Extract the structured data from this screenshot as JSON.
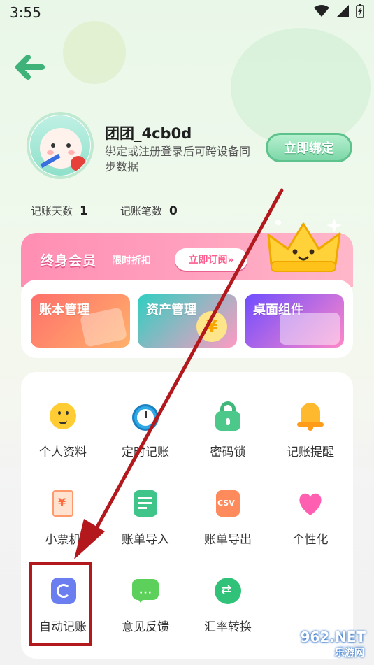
{
  "status_bar": {
    "time": "3:55"
  },
  "profile": {
    "username": "团团_4cb0d",
    "description": "绑定或注册登录后可跨设备同步数据",
    "bind_button": "立即绑定"
  },
  "stats": [
    {
      "label": "记账天数",
      "value": "1"
    },
    {
      "label": "记账笔数",
      "value": "0"
    }
  ],
  "vip": {
    "title": "终身会员",
    "subtitle": "限时折扣",
    "button": "立即订阅»"
  },
  "feature_cards": [
    {
      "label": "账本管理",
      "color_from": "#ff7a6b",
      "color_to": "#ffb36b"
    },
    {
      "label": "资产管理",
      "color_from": "#37d1c4",
      "color_to": "#ff9ac2"
    },
    {
      "label": "桌面组件",
      "color_from": "#7b5cff",
      "color_to": "#ff8acb"
    }
  ],
  "grid": [
    {
      "label": "个人资料",
      "icon": "smiley-face-icon"
    },
    {
      "label": "定时记账",
      "icon": "alarm-clock-icon"
    },
    {
      "label": "密码锁",
      "icon": "padlock-icon"
    },
    {
      "label": "记账提醒",
      "icon": "bell-icon"
    },
    {
      "label": "小票机",
      "icon": "receipt-icon"
    },
    {
      "label": "账单导入",
      "icon": "import-doc-icon"
    },
    {
      "label": "账单导出",
      "icon": "csv-export-icon"
    },
    {
      "label": "个性化",
      "icon": "heart-icon"
    },
    {
      "label": "自动记账",
      "icon": "sync-icon"
    },
    {
      "label": "意见反馈",
      "icon": "chat-bubble-icon"
    },
    {
      "label": "汇率转换",
      "icon": "exchange-icon"
    }
  ],
  "watermark": {
    "line1": "962.NET",
    "line2": "乐游网"
  },
  "colors": {
    "accent_green": "#5ec28d",
    "vip_pink": "#ff8fb3",
    "annotation_red": "#b3191c"
  }
}
